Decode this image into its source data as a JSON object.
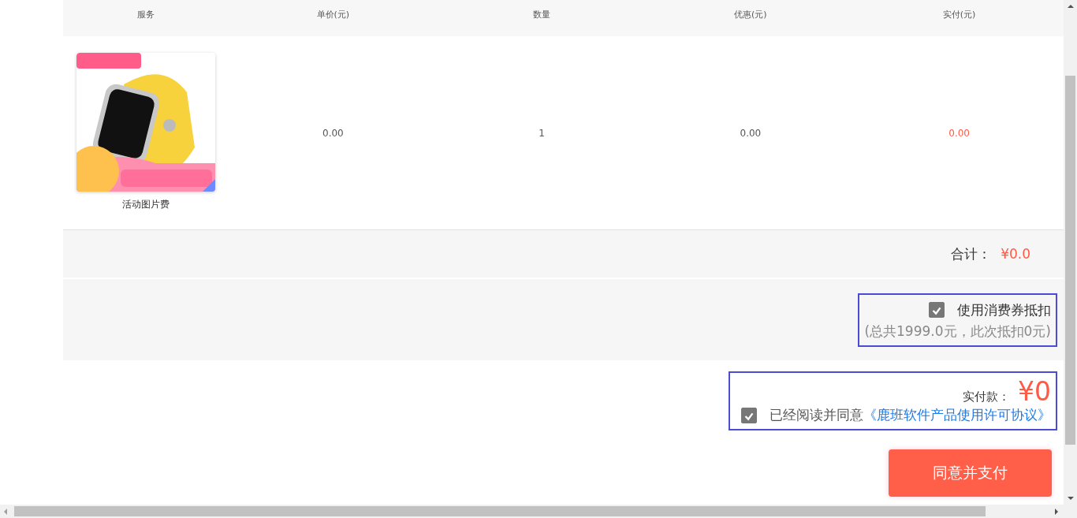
{
  "table": {
    "columns": [
      "服务",
      "单价(元)",
      "数量",
      "优惠(元)",
      "实付(元)"
    ],
    "rows": [
      {
        "service": {
          "kind": "picture",
          "caption": "活动图片费"
        },
        "unit_price": "0.00",
        "quantity": "1",
        "discount": "0.00",
        "paid": "0.00"
      }
    ]
  },
  "total": {
    "label": "合计：",
    "value": "¥0.0"
  },
  "coupon": {
    "checked": true,
    "label": "使用消费券抵扣",
    "note": "(总共1999.0元，此次抵扣0元)"
  },
  "payment": {
    "label": "实付款：",
    "amount": "¥0"
  },
  "agreement": {
    "checked": true,
    "text": "已经阅读并同意",
    "link": "《鹿班软件产品使用许可协议》"
  },
  "pay_button": "同意并支付"
}
